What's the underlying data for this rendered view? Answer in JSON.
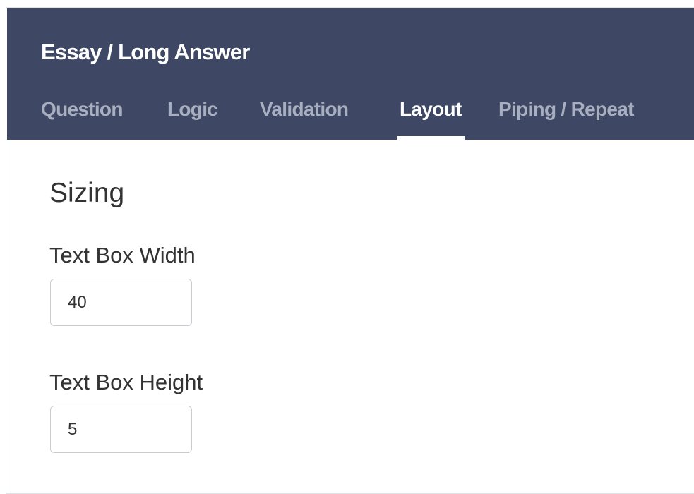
{
  "dialog": {
    "title": "Essay / Long Answer"
  },
  "tabs": [
    {
      "label": "Question",
      "active": false
    },
    {
      "label": "Logic",
      "active": false
    },
    {
      "label": "Validation",
      "active": false
    },
    {
      "label": "Layout",
      "active": true
    },
    {
      "label": "Piping / Repeat",
      "active": false
    }
  ],
  "sizing": {
    "section_title": "Sizing",
    "width_label": "Text Box Width",
    "width_value": "40",
    "height_label": "Text Box Height",
    "height_value": "5"
  },
  "colors": {
    "header_background": "#3e4864",
    "active_tab": "#ffffff",
    "inactive_tab": "#a8afc0"
  }
}
